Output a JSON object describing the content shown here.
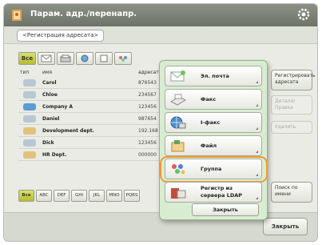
{
  "header": {
    "title": "Парам. адр./перенапр.",
    "settings_icon": "gear-icon"
  },
  "tab": {
    "label": "<Регистрация адресата>"
  },
  "toolbar": {
    "all_label": "Все"
  },
  "columns": {
    "type": "тип",
    "name": "имя",
    "address": "адресат"
  },
  "list": [
    {
      "icon": "mail-icon",
      "name": "Carol",
      "address": "876543"
    },
    {
      "icon": "mail-icon",
      "name": "Chloe",
      "address": "234567"
    },
    {
      "icon": "ifax-icon",
      "name": "Company A",
      "address": "123456"
    },
    {
      "icon": "mail-icon",
      "name": "Daniel",
      "address": "987654"
    },
    {
      "icon": "group-icon",
      "name": "Development dept.",
      "address": "192.168"
    },
    {
      "icon": "mail-icon",
      "name": "Dick",
      "address": "123456"
    },
    {
      "icon": "group-icon",
      "name": "HR Dept.",
      "address": "000000"
    }
  ],
  "alpha_tabs": [
    "Все",
    "ABC",
    "DEF",
    "GHI",
    "JKL",
    "MNO",
    "PQRS"
  ],
  "right_buttons": {
    "register": "Регистрировать адресата",
    "details": "Детали/Правка",
    "delete": "Удалить",
    "search": "Поиск по имени"
  },
  "bottom": {
    "close_label": "Закрыть"
  },
  "popup": {
    "items": [
      {
        "icon": "email-icon",
        "label": "Эл. почта"
      },
      {
        "icon": "fax-icon",
        "label": "Факс"
      },
      {
        "icon": "ifax-icon",
        "label": "I-факс"
      },
      {
        "icon": "file-icon",
        "label": "Файл"
      },
      {
        "icon": "group-icon",
        "label": "Группа"
      },
      {
        "icon": "ldap-server-icon",
        "label": "Регистр из сервера LDAP"
      }
    ],
    "close_label": "Закрыть"
  },
  "colors": {
    "accent": "#f29a2e",
    "header": "#7c8177",
    "popup_bg": "#d9ecd2",
    "active_tab": "#c7cd4a"
  }
}
